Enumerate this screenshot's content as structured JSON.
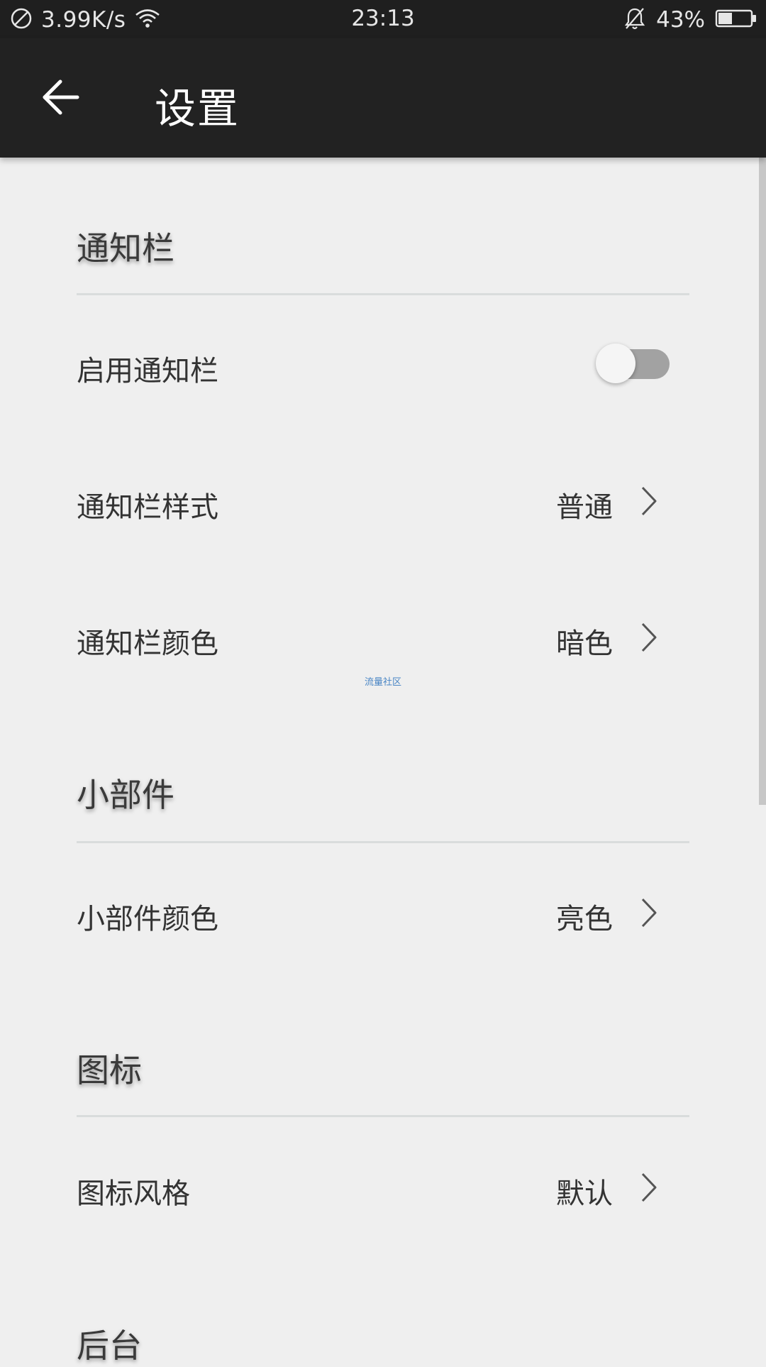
{
  "status_bar": {
    "speed": "3.99K/s",
    "time": "23:13",
    "battery_percent": "43%",
    "battery_level": 0.43,
    "icons": [
      "no-sim-icon",
      "wifi-icon",
      "bell-off-icon",
      "battery-icon"
    ]
  },
  "app_bar": {
    "title": "设置",
    "back_icon": "arrow-left-icon"
  },
  "sections": {
    "notification": {
      "title": "通知栏",
      "enable_label": "启用通知栏",
      "enable_on": false,
      "style_label": "通知栏样式",
      "style_value": "普通",
      "color_label": "通知栏颜色",
      "color_value": "暗色"
    },
    "widget": {
      "title": "小部件",
      "color_label": "小部件颜色",
      "color_value": "亮色"
    },
    "icon": {
      "title": "图标",
      "style_label": "图标风格",
      "style_value": "默认"
    },
    "background": {
      "title": "后台"
    }
  },
  "watermark": "流量社区",
  "colors": {
    "status_bar_bg": "#1f1f1f",
    "app_bar_bg": "#222222",
    "page_bg": "#efefef",
    "toggle_track": "#a2a2a2",
    "watermark": "#4a86c5"
  }
}
